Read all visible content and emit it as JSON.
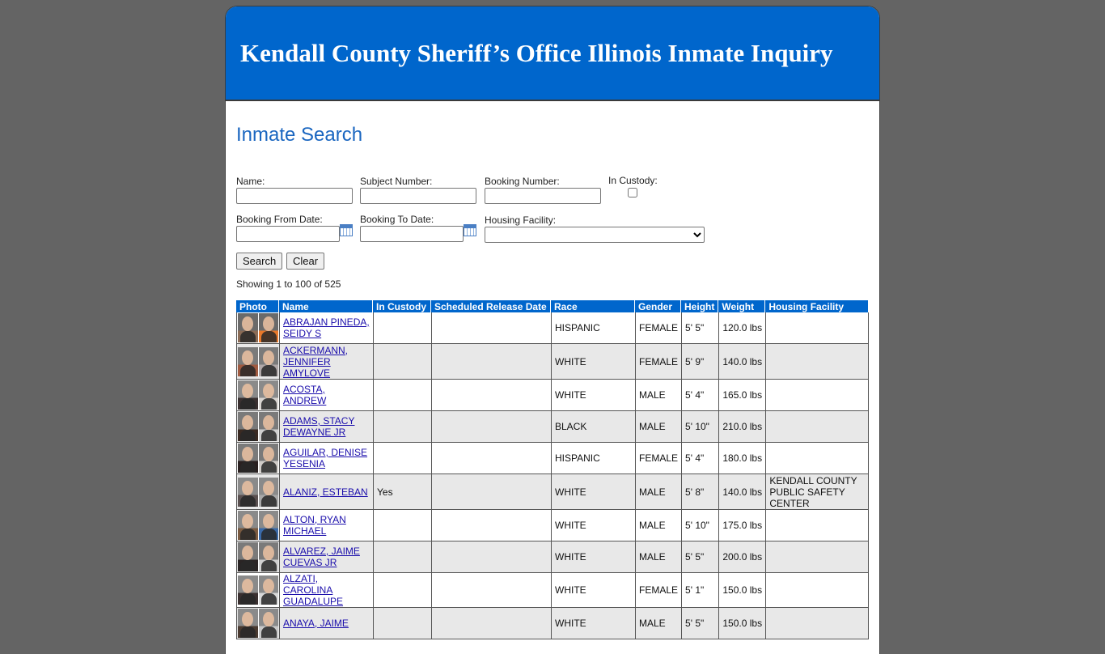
{
  "header": {
    "title": "Kendall County Sheriff’s Office Illinois Inmate Inquiry"
  },
  "search": {
    "heading": "Inmate Search",
    "name_label": "Name:",
    "name_value": "",
    "subject_label": "Subject Number:",
    "subject_value": "",
    "booking_label": "Booking Number:",
    "booking_value": "",
    "custody_label": "In Custody:",
    "from_label": "Booking From Date:",
    "from_value": "",
    "to_label": "Booking To Date:",
    "to_value": "",
    "housing_label": "Housing Facility:",
    "housing_value": "",
    "search_button": "Search",
    "clear_button": "Clear",
    "calendar_icon": "calendar-icon"
  },
  "results": {
    "showing": "Showing 1 to 100 of 525",
    "columns": [
      "Photo",
      "Name",
      "In Custody",
      "Scheduled Release Date",
      "Race",
      "Gender",
      "Height",
      "Weight",
      "Housing Facility"
    ],
    "rows": [
      {
        "name_lines": [
          "ABRAJAN PINEDA,",
          "SEIDY S"
        ],
        "custody": "",
        "release": "",
        "race": "HISPANIC",
        "gender": "FEMALE",
        "height": "5' 5\"",
        "weight": "120.0 lbs",
        "housing_lines": [],
        "colors": [
          "#8a6b55",
          "#e8782a",
          "#6a6a6a"
        ]
      },
      {
        "name_lines": [
          "ACKERMANN,",
          "JENNIFER",
          "AMYLOVE"
        ],
        "custody": "",
        "release": "",
        "race": "WHITE",
        "gender": "FEMALE",
        "height": "5' 9\"",
        "weight": "140.0 lbs",
        "housing_lines": [],
        "colors": [
          "#a05a40",
          "#b0a8a8",
          "#7a7a7a"
        ]
      },
      {
        "name_lines": [
          "ACOSTA, ANDREW"
        ],
        "custody": "",
        "release": "",
        "race": "WHITE",
        "gender": "MALE",
        "height": "5' 4\"",
        "weight": "165.0 lbs",
        "housing_lines": [],
        "colors": [
          "#3a3030",
          "#d8d4d0",
          "#8a8a8a"
        ]
      },
      {
        "name_lines": [
          "ADAMS, STACY",
          "DEWAYNE JR"
        ],
        "custody": "",
        "release": "",
        "race": "BLACK",
        "gender": "MALE",
        "height": "5' 10\"",
        "weight": "210.0 lbs",
        "housing_lines": [],
        "colors": [
          "#3a2a22",
          "#cfcfcf",
          "#7a7a7a"
        ]
      },
      {
        "name_lines": [
          "AGUILAR, DENISE",
          "YESENIA"
        ],
        "custody": "",
        "release": "",
        "race": "HISPANIC",
        "gender": "FEMALE",
        "height": "5' 4\"",
        "weight": "180.0 lbs",
        "housing_lines": [],
        "colors": [
          "#2a2020",
          "#d0ccc8",
          "#7a7a7a"
        ]
      },
      {
        "name_lines": [
          "ALANIZ, ESTEBAN"
        ],
        "custody": "Yes",
        "release": "",
        "race": "WHITE",
        "gender": "MALE",
        "height": "5' 8\"",
        "weight": "140.0 lbs",
        "housing_lines": [
          "KENDALL COUNTY",
          "PUBLIC SAFETY",
          "CENTER"
        ],
        "colors": [
          "#5a5050",
          "#a8a8a8",
          "#8a8a8a"
        ]
      },
      {
        "name_lines": [
          "ALTON, RYAN",
          "MICHAEL"
        ],
        "custody": "",
        "release": "",
        "race": "WHITE",
        "gender": "MALE",
        "height": "5' 10\"",
        "weight": "175.0 lbs",
        "housing_lines": [],
        "colors": [
          "#7a5a40",
          "#3a6aa8",
          "#8a8a8a"
        ]
      },
      {
        "name_lines": [
          "ALVAREZ, JAIME",
          "CUEVAS JR"
        ],
        "custody": "",
        "release": "",
        "race": "WHITE",
        "gender": "MALE",
        "height": "5' 5\"",
        "weight": "200.0 lbs",
        "housing_lines": [],
        "colors": [
          "#2a2424",
          "#d0d0d0",
          "#7a7a7a"
        ]
      },
      {
        "name_lines": [
          "ALZATI, CAROLINA",
          "GUADALUPE"
        ],
        "custody": "",
        "release": "",
        "race": "WHITE",
        "gender": "FEMALE",
        "height": "5' 1\"",
        "weight": "150.0 lbs",
        "housing_lines": [],
        "colors": [
          "#3a3030",
          "#d8d8d8",
          "#8a8a8a"
        ]
      },
      {
        "name_lines": [
          "ANAYA, JAIME"
        ],
        "custody": "",
        "release": "",
        "race": "WHITE",
        "gender": "MALE",
        "height": "5' 5\"",
        "weight": "150.0 lbs",
        "housing_lines": [],
        "colors": [
          "#4a3a30",
          "#c8c8c8",
          "#8a8a8a"
        ]
      }
    ]
  }
}
